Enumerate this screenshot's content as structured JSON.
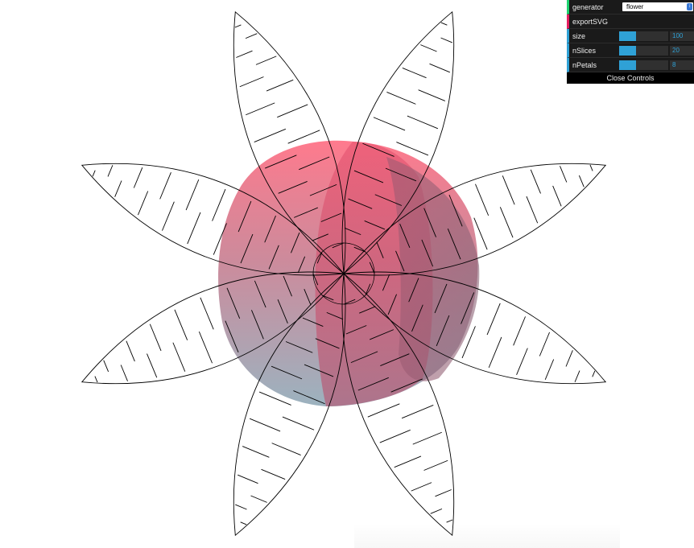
{
  "controls": {
    "generator_label": "generator",
    "generator_value": "flower",
    "export_label": "exportSVG",
    "size": {
      "label": "size",
      "value": "100",
      "fraction": 0.35
    },
    "nSlices": {
      "label": "nSlices",
      "value": "20",
      "fraction": 0.35
    },
    "nPetals": {
      "label": "nPetals",
      "value": "8",
      "fraction": 0.35
    },
    "close_label": "Close Controls"
  },
  "colors": {
    "accent": "#2fa1d6",
    "generator_accent": "#1ed36f",
    "function_accent": "#e61d5f",
    "sphere_top": "#ff6b7f",
    "sphere_bottom": "#8aa4b4",
    "stroke": "#000000"
  },
  "icons": {
    "select_caret": "chevron-updown-icon"
  }
}
